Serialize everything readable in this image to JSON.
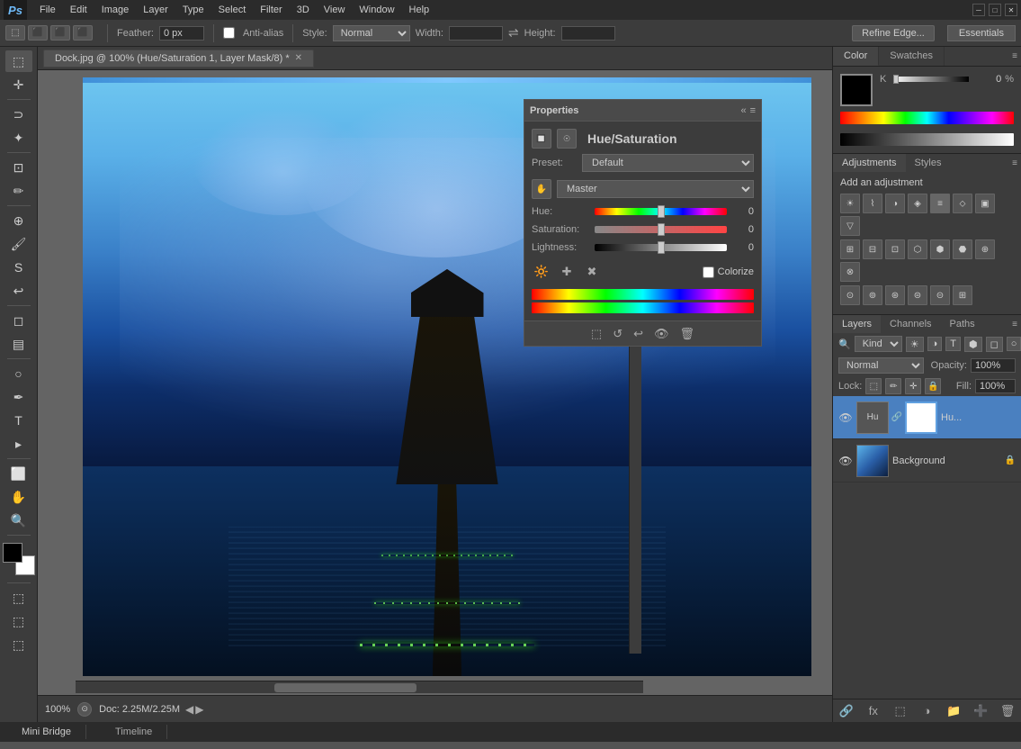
{
  "app": {
    "title": "Adobe Photoshop",
    "logo": "Ps"
  },
  "menu": {
    "items": [
      "Ps",
      "File",
      "Edit",
      "Image",
      "Layer",
      "Type",
      "Select",
      "Filter",
      "3D",
      "View",
      "Window",
      "Help"
    ]
  },
  "options_bar": {
    "feather_label": "Feather:",
    "feather_value": "0 px",
    "anti_alias_label": "Anti-alias",
    "style_label": "Style:",
    "style_value": "Normal",
    "width_label": "Width:",
    "height_label": "Height:",
    "refine_edge_btn": "Refine Edge..."
  },
  "essentials_btn": "Essentials",
  "tab": {
    "title": "Dock.jpg @ 100% (Hue/Saturation 1, Layer Mask/8) *"
  },
  "properties_panel": {
    "title": "Properties",
    "hue_sat_title": "Hue/Saturation",
    "preset_label": "Preset:",
    "preset_value": "Default",
    "channel_value": "Master",
    "hue_label": "Hue:",
    "hue_value": "0",
    "saturation_label": "Saturation:",
    "saturation_value": "0",
    "lightness_label": "Lightness:",
    "lightness_value": "0",
    "colorize_label": "Colorize"
  },
  "color_panel": {
    "tab_color": "Color",
    "tab_swatches": "Swatches",
    "k_label": "K",
    "k_value": "0",
    "k_pct": "%"
  },
  "adjustments_panel": {
    "title": "Add an adjustment",
    "tab_adjustments": "Adjustments",
    "tab_styles": "Styles"
  },
  "layers_panel": {
    "tab_layers": "Layers",
    "tab_channels": "Channels",
    "tab_paths": "Paths",
    "kind_label": "Kind",
    "normal_label": "Normal",
    "opacity_label": "Opacity:",
    "opacity_value": "100%",
    "lock_label": "Lock:",
    "fill_label": "Fill:",
    "fill_value": "100%",
    "layers": [
      {
        "name": "Hu...",
        "visible": true,
        "active": true,
        "has_mask": true
      },
      {
        "name": "Background",
        "visible": true,
        "active": false,
        "has_mask": false
      }
    ]
  },
  "bottom": {
    "zoom": "100%",
    "doc_info": "Doc: 2.25M/2.25M"
  },
  "status_bar": {
    "mini_bridge": "Mini Bridge",
    "timeline": "Timeline"
  },
  "tools": {
    "list": [
      "⬚",
      "⬛",
      "⬛",
      "⬛",
      "⬛",
      "✂",
      "✏",
      "✏",
      "S",
      "⬚",
      "⬚",
      "T",
      "A",
      "☁",
      "☁",
      "⬚",
      "🔍",
      "⬚",
      "⬚"
    ]
  }
}
